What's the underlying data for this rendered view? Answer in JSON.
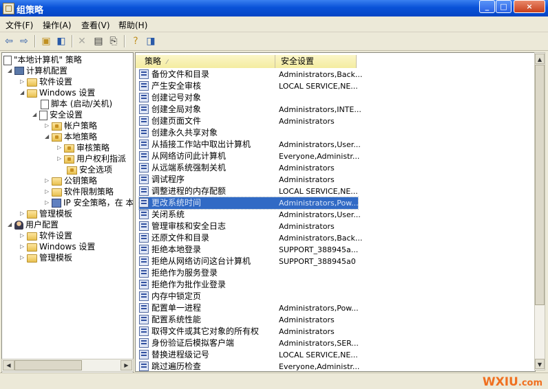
{
  "window": {
    "title": "组策略",
    "btn_min": "_",
    "btn_max": "□",
    "btn_close": "×"
  },
  "menu": [
    "文件(F)",
    "操作(A)",
    "查看(V)",
    "帮助(H)"
  ],
  "tree": {
    "root": "\"本地计算机\" 策略",
    "computer_config": "计算机配置",
    "software_settings": "软件设置",
    "windows_settings": "Windows 设置",
    "scripts": "脚本 (启动/关机)",
    "security_settings": "安全设置",
    "account_policy": "帐户策略",
    "local_policy": "本地策略",
    "audit_policy": "审核策略",
    "user_rights": "用户权利指派",
    "security_options": "安全选项",
    "public_key": "公钥策略",
    "software_restriction": "软件限制策略",
    "ipsec": "IP 安全策略，在 本",
    "admin_templates": "管理模板",
    "user_config": "用户配置",
    "u_software_settings": "软件设置",
    "u_windows_settings": "Windows 设置",
    "u_admin_templates": "管理模板"
  },
  "list": {
    "col_policy": "策略",
    "col_setting": "安全设置",
    "rows": [
      {
        "policy": "备份文件和目录",
        "setting": "Administrators,Back..."
      },
      {
        "policy": "产生安全审核",
        "setting": "LOCAL SERVICE,NE..."
      },
      {
        "policy": "创建记号对象",
        "setting": ""
      },
      {
        "policy": "创建全局对象",
        "setting": "Administrators,INTE..."
      },
      {
        "policy": "创建页面文件",
        "setting": "Administrators"
      },
      {
        "policy": "创建永久共享对象",
        "setting": ""
      },
      {
        "policy": "从插接工作站中取出计算机",
        "setting": "Administrators,User..."
      },
      {
        "policy": "从网络访问此计算机",
        "setting": "Everyone,Administr..."
      },
      {
        "policy": "从远端系统强制关机",
        "setting": "Administrators"
      },
      {
        "policy": "调试程序",
        "setting": "Administrators"
      },
      {
        "policy": "调整进程的内存配额",
        "setting": "LOCAL SERVICE,NE..."
      },
      {
        "policy": "更改系统时间",
        "setting": "Administrators,Pow..."
      },
      {
        "policy": "关闭系统",
        "setting": "Administrators,User..."
      },
      {
        "policy": "管理审核和安全日志",
        "setting": "Administrators"
      },
      {
        "policy": "还原文件和目录",
        "setting": "Administrators,Back..."
      },
      {
        "policy": "拒绝本地登录",
        "setting": "SUPPORT_388945a..."
      },
      {
        "policy": "拒绝从网络访问这台计算机",
        "setting": "SUPPORT_388945a0"
      },
      {
        "policy": "拒绝作为服务登录",
        "setting": ""
      },
      {
        "policy": "拒绝作为批作业登录",
        "setting": ""
      },
      {
        "policy": "内存中锁定页",
        "setting": ""
      },
      {
        "policy": "配置单一进程",
        "setting": "Administrators,Pow..."
      },
      {
        "policy": "配置系统性能",
        "setting": "Administrators"
      },
      {
        "policy": "取得文件或其它对象的所有权",
        "setting": "Administrators"
      },
      {
        "policy": "身份验证后模拟客户端",
        "setting": "Administrators,SER..."
      },
      {
        "policy": "替换进程级记号",
        "setting": "LOCAL SERVICE,NE..."
      },
      {
        "policy": "跳过遍历检查",
        "setting": "Everyone,Administr..."
      }
    ]
  },
  "watermark": {
    "text": "WXIU",
    "suffix": ".com"
  }
}
